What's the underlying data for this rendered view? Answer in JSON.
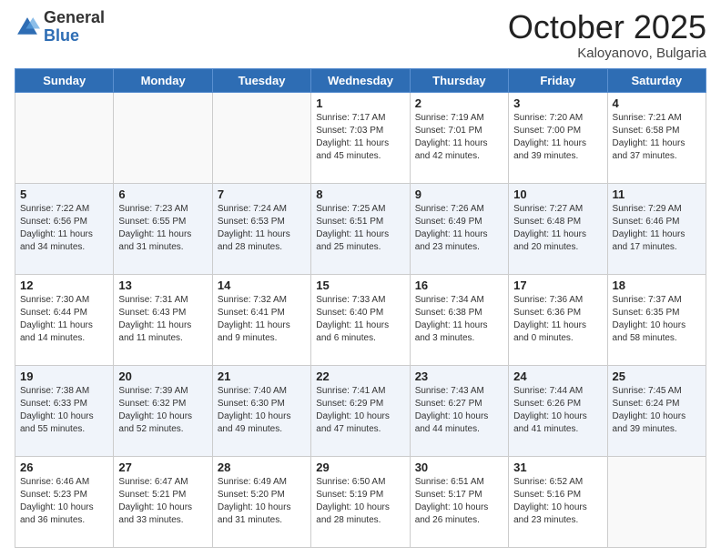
{
  "header": {
    "logo_general": "General",
    "logo_blue": "Blue",
    "month": "October 2025",
    "location": "Kaloyanovo, Bulgaria"
  },
  "days_of_week": [
    "Sunday",
    "Monday",
    "Tuesday",
    "Wednesday",
    "Thursday",
    "Friday",
    "Saturday"
  ],
  "weeks": [
    {
      "alt": false,
      "days": [
        {
          "num": "",
          "info": ""
        },
        {
          "num": "",
          "info": ""
        },
        {
          "num": "",
          "info": ""
        },
        {
          "num": "1",
          "info": "Sunrise: 7:17 AM\nSunset: 7:03 PM\nDaylight: 11 hours\nand 45 minutes."
        },
        {
          "num": "2",
          "info": "Sunrise: 7:19 AM\nSunset: 7:01 PM\nDaylight: 11 hours\nand 42 minutes."
        },
        {
          "num": "3",
          "info": "Sunrise: 7:20 AM\nSunset: 7:00 PM\nDaylight: 11 hours\nand 39 minutes."
        },
        {
          "num": "4",
          "info": "Sunrise: 7:21 AM\nSunset: 6:58 PM\nDaylight: 11 hours\nand 37 minutes."
        }
      ]
    },
    {
      "alt": true,
      "days": [
        {
          "num": "5",
          "info": "Sunrise: 7:22 AM\nSunset: 6:56 PM\nDaylight: 11 hours\nand 34 minutes."
        },
        {
          "num": "6",
          "info": "Sunrise: 7:23 AM\nSunset: 6:55 PM\nDaylight: 11 hours\nand 31 minutes."
        },
        {
          "num": "7",
          "info": "Sunrise: 7:24 AM\nSunset: 6:53 PM\nDaylight: 11 hours\nand 28 minutes."
        },
        {
          "num": "8",
          "info": "Sunrise: 7:25 AM\nSunset: 6:51 PM\nDaylight: 11 hours\nand 25 minutes."
        },
        {
          "num": "9",
          "info": "Sunrise: 7:26 AM\nSunset: 6:49 PM\nDaylight: 11 hours\nand 23 minutes."
        },
        {
          "num": "10",
          "info": "Sunrise: 7:27 AM\nSunset: 6:48 PM\nDaylight: 11 hours\nand 20 minutes."
        },
        {
          "num": "11",
          "info": "Sunrise: 7:29 AM\nSunset: 6:46 PM\nDaylight: 11 hours\nand 17 minutes."
        }
      ]
    },
    {
      "alt": false,
      "days": [
        {
          "num": "12",
          "info": "Sunrise: 7:30 AM\nSunset: 6:44 PM\nDaylight: 11 hours\nand 14 minutes."
        },
        {
          "num": "13",
          "info": "Sunrise: 7:31 AM\nSunset: 6:43 PM\nDaylight: 11 hours\nand 11 minutes."
        },
        {
          "num": "14",
          "info": "Sunrise: 7:32 AM\nSunset: 6:41 PM\nDaylight: 11 hours\nand 9 minutes."
        },
        {
          "num": "15",
          "info": "Sunrise: 7:33 AM\nSunset: 6:40 PM\nDaylight: 11 hours\nand 6 minutes."
        },
        {
          "num": "16",
          "info": "Sunrise: 7:34 AM\nSunset: 6:38 PM\nDaylight: 11 hours\nand 3 minutes."
        },
        {
          "num": "17",
          "info": "Sunrise: 7:36 AM\nSunset: 6:36 PM\nDaylight: 11 hours\nand 0 minutes."
        },
        {
          "num": "18",
          "info": "Sunrise: 7:37 AM\nSunset: 6:35 PM\nDaylight: 10 hours\nand 58 minutes."
        }
      ]
    },
    {
      "alt": true,
      "days": [
        {
          "num": "19",
          "info": "Sunrise: 7:38 AM\nSunset: 6:33 PM\nDaylight: 10 hours\nand 55 minutes."
        },
        {
          "num": "20",
          "info": "Sunrise: 7:39 AM\nSunset: 6:32 PM\nDaylight: 10 hours\nand 52 minutes."
        },
        {
          "num": "21",
          "info": "Sunrise: 7:40 AM\nSunset: 6:30 PM\nDaylight: 10 hours\nand 49 minutes."
        },
        {
          "num": "22",
          "info": "Sunrise: 7:41 AM\nSunset: 6:29 PM\nDaylight: 10 hours\nand 47 minutes."
        },
        {
          "num": "23",
          "info": "Sunrise: 7:43 AM\nSunset: 6:27 PM\nDaylight: 10 hours\nand 44 minutes."
        },
        {
          "num": "24",
          "info": "Sunrise: 7:44 AM\nSunset: 6:26 PM\nDaylight: 10 hours\nand 41 minutes."
        },
        {
          "num": "25",
          "info": "Sunrise: 7:45 AM\nSunset: 6:24 PM\nDaylight: 10 hours\nand 39 minutes."
        }
      ]
    },
    {
      "alt": false,
      "days": [
        {
          "num": "26",
          "info": "Sunrise: 6:46 AM\nSunset: 5:23 PM\nDaylight: 10 hours\nand 36 minutes."
        },
        {
          "num": "27",
          "info": "Sunrise: 6:47 AM\nSunset: 5:21 PM\nDaylight: 10 hours\nand 33 minutes."
        },
        {
          "num": "28",
          "info": "Sunrise: 6:49 AM\nSunset: 5:20 PM\nDaylight: 10 hours\nand 31 minutes."
        },
        {
          "num": "29",
          "info": "Sunrise: 6:50 AM\nSunset: 5:19 PM\nDaylight: 10 hours\nand 28 minutes."
        },
        {
          "num": "30",
          "info": "Sunrise: 6:51 AM\nSunset: 5:17 PM\nDaylight: 10 hours\nand 26 minutes."
        },
        {
          "num": "31",
          "info": "Sunrise: 6:52 AM\nSunset: 5:16 PM\nDaylight: 10 hours\nand 23 minutes."
        },
        {
          "num": "",
          "info": ""
        }
      ]
    }
  ]
}
